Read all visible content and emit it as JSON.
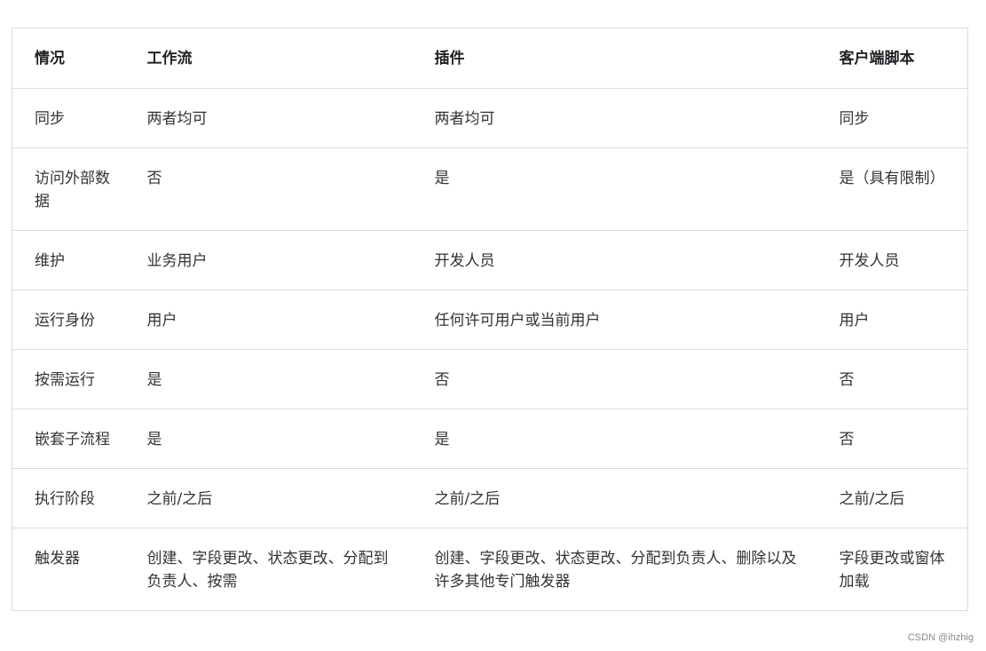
{
  "table": {
    "headers": [
      "情况",
      "工作流",
      "插件",
      "客户端脚本"
    ],
    "rows": [
      [
        "同步",
        "两者均可",
        "两者均可",
        "同步"
      ],
      [
        "访问外部数据",
        "否",
        "是",
        "是（具有限制）"
      ],
      [
        "维护",
        "业务用户",
        "开发人员",
        "开发人员"
      ],
      [
        "运行身份",
        "用户",
        "任何许可用户或当前用户",
        "用户"
      ],
      [
        "按需运行",
        "是",
        "否",
        "否"
      ],
      [
        "嵌套子流程",
        "是",
        "是",
        "否"
      ],
      [
        "执行阶段",
        "之前/之后",
        "之前/之后",
        "之前/之后"
      ],
      [
        "触发器",
        "创建、字段更改、状态更改、分配到负责人、按需",
        "创建、字段更改、状态更改、分配到负责人、删除以及许多其他专门触发器",
        "字段更改或窗体加载"
      ]
    ]
  },
  "watermark": "CSDN @ihzhig"
}
